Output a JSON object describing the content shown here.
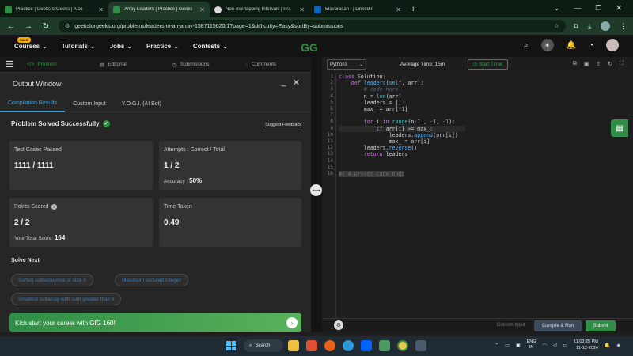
{
  "browser": {
    "tabs": [
      {
        "title": "Practice | GeeksforGeeks | A co",
        "fav": "#2f8d46",
        "active": false
      },
      {
        "title": "Array Leaders | Practice | Geeks",
        "fav": "#2f8d46",
        "active": true
      },
      {
        "title": "Non-overlapping Intervals | Pra",
        "fav": "#ddd",
        "active": false
      },
      {
        "title": "Elavarasan I | LinkedIn",
        "fav": "#0a66c2",
        "active": false
      }
    ],
    "url": "geeksforgeeks.org/problems/leaders-in-an-array-1587115620/1?page=1&difficulty=Easy&sortBy=submissions"
  },
  "site_nav": {
    "items": [
      "Courses",
      "Tutorials",
      "Jobs",
      "Practice",
      "Contests"
    ],
    "sale_badge": "SALE",
    "logo": "GG"
  },
  "problem_tabs": [
    "Problem",
    "Editorial",
    "Submissions",
    "Comments"
  ],
  "output": {
    "title": "Output Window",
    "subtabs": [
      "Compilation Results",
      "Custom Input",
      "Y.O.G.I. (AI Bot)"
    ],
    "status": "Problem Solved Successfully",
    "feedback": "Suggest Feedback",
    "cards": {
      "tests_label": "Test Cases Passed",
      "tests_value": "1111 / 1111",
      "attempts_label": "Attempts : Correct / Total",
      "attempts_value": "1 / 2",
      "accuracy_label": "Accuracy :",
      "accuracy_value": "50%",
      "points_label": "Points Scored",
      "points_value": "2 / 2",
      "total_label": "Your Total Score:",
      "total_value": "164",
      "time_label": "Time Taken",
      "time_value": "0.49"
    },
    "solve_next_title": "Solve Next",
    "solve_next": [
      "Sorted subsequence of size 3",
      "Maximum occured integer",
      "Smallest subarray with sum greater than x"
    ],
    "banner": "Kick start your career with GfG 160!"
  },
  "editor": {
    "language": "Python3",
    "avg_time": "Average Time: 15m",
    "start_timer": "Start Timer",
    "ghost_line": "#{ # Driver Code Ends",
    "custom_input": "Custom Input",
    "compile": "Compile & Run",
    "submit": "Submit"
  },
  "taskbar": {
    "search": "Search",
    "lang_top": "ENG",
    "lang_bottom": "IN",
    "time": "11:03:25 PM",
    "date": "11-12-2024"
  },
  "colors": {
    "brand": "#2f8d46",
    "link": "#3aa0d8"
  }
}
